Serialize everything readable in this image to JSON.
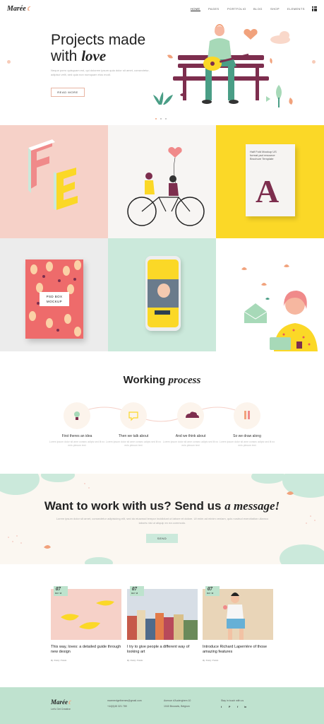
{
  "header": {
    "logo": "Marée",
    "nav": [
      "HOME",
      "PAGES",
      "PORTFOLIO",
      "BLOG",
      "SHOP",
      "ELEMENTS"
    ]
  },
  "hero": {
    "title_line1": "Projects made",
    "title_line2_prefix": "with ",
    "title_line2_em": "love",
    "text": "Neque porro quisquam est, qui dolorem ipsum quia dolor sit amet, consectetur, adipisci velit, sed quia non numquam eius modi.",
    "button": "READ MORE"
  },
  "tiles": {
    "mockup_card_text": "Half Fold Mockup US format psd resource Brochure Template",
    "book_label_line1": "PSD BOX",
    "book_label_line2": "MOCKUP"
  },
  "process": {
    "title_prefix": "Working ",
    "title_em": "process",
    "steps": [
      {
        "title": "First theres an idea",
        "text": "Lorem ipsum dolor sit ame consec adipis sed lit no enis plexum text"
      },
      {
        "title": "Then we talk about",
        "text": "Lorem ipsum dolor sit ame consec adipis sed lit no enis plexum text"
      },
      {
        "title": "And we think about",
        "text": "Lorem ipsum dolor sit ame consec adipis sed lit no enis plexum text"
      },
      {
        "title": "So we draw along",
        "text": "Lorem ipsum dolor sit ame consec adipis sed lit no enis plexum text"
      }
    ]
  },
  "cta": {
    "title_prefix": "Want to work with us? Send us ",
    "title_em": "a message!",
    "text": "Lorem ipsum dolor sit amet, consectetur adipisicing elit, sed do eiusmod tempor incididunt ut labore et dolore. Ut enim ad minim veniam, quis nostrud exercitation ullamco laboris nisi ut aliquip ex ea commodo.",
    "button": "SEND"
  },
  "blog": {
    "posts": [
      {
        "day": "07",
        "month": "MAY '18",
        "title": "This way, loves: a detailed guide through new design",
        "by": "By Emily Fields"
      },
      {
        "day": "07",
        "month": "MAY '18",
        "title": "I try to give people a different way of looking art",
        "by": "By Emily Fields"
      },
      {
        "day": "07",
        "month": "MAY '18",
        "title": "Introduce Richard Laperrière of those amazing features",
        "by": "By Emily Fields"
      }
    ]
  },
  "footer": {
    "logo": "Marée",
    "tagline": "Let's Get Creative",
    "email": "mareeedgethemes@gmail.com",
    "phone": "+44(0)45 321 789",
    "address_line1": "Avenue d'Auderghem 10",
    "address_line2": "1040 Brussels, Belgium",
    "social_title": "Stay in touch with us",
    "social": [
      "t",
      "P",
      "f",
      "in"
    ]
  },
  "colors": {
    "pink": "#f6d1c8",
    "mint": "#cbe9db",
    "yellow": "#fbd827",
    "peach": "#f1a27c",
    "plum": "#7d2e4e"
  }
}
